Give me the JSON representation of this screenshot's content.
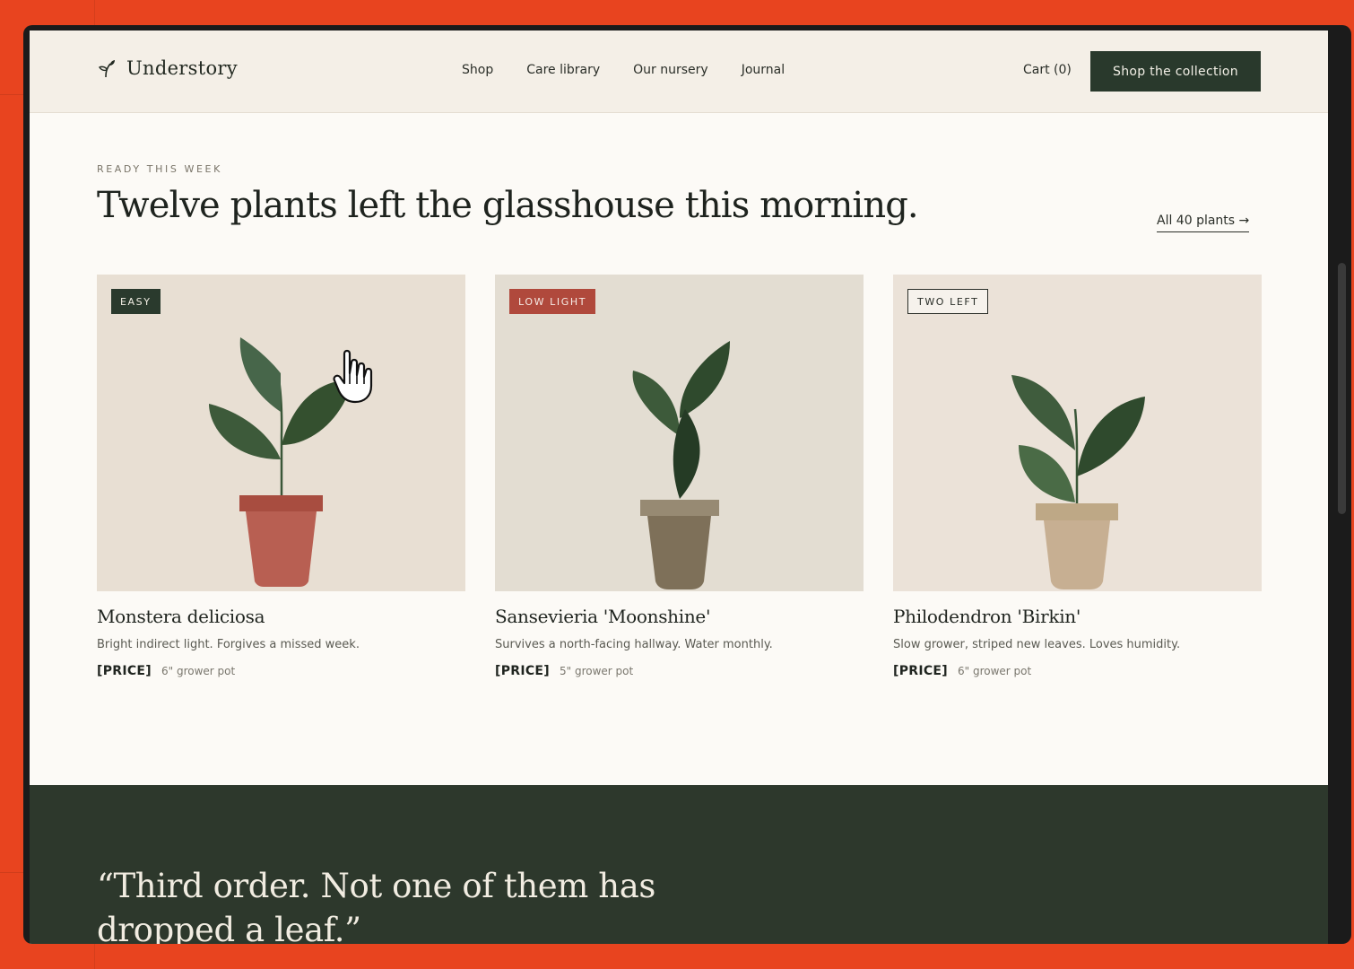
{
  "header": {
    "brand_name": "Understory",
    "nav": [
      "Shop",
      "Care library",
      "Our nursery",
      "Journal"
    ],
    "cart_label": "Cart (0)",
    "cta_label": "Shop the collection"
  },
  "section": {
    "eyebrow": "READY THIS WEEK",
    "headline": "Twelve plants left the glasshouse this morning.",
    "all_link": "All 40 plants →"
  },
  "products": [
    {
      "badge": "EASY",
      "name": "Monstera deliciosa",
      "description": "Bright indirect light. Forgives a missed week.",
      "price": "[PRICE]",
      "pot_size": "6\" grower pot",
      "pot_color": "#b85f52",
      "rim_color": "#a84d40",
      "bg_color": "#e8dfd3"
    },
    {
      "badge": "LOW LIGHT",
      "name": "Sansevieria 'Moonshine'",
      "description": "Survives a north-facing hallway. Water monthly.",
      "price": "[PRICE]",
      "pot_size": "5\" grower pot",
      "pot_color": "#7e7059",
      "rim_color": "#978a73",
      "bg_color": "#e3ddd2"
    },
    {
      "badge": "TWO LEFT",
      "name": "Philodendron 'Birkin'",
      "description": "Slow grower, striped new leaves. Loves humidity.",
      "price": "[PRICE]",
      "pot_size": "6\" grower pot",
      "pot_color": "#c7af92",
      "rim_color": "#bea886",
      "bg_color": "#ebe2d8"
    }
  ],
  "testimonial": {
    "quote": "“Third order. Not one of them has dropped a leaf.”"
  },
  "colors": {
    "accent_dark_green": "#29392c",
    "page_frame": "#e8441f",
    "leaf_green": "#3d5a3a"
  }
}
